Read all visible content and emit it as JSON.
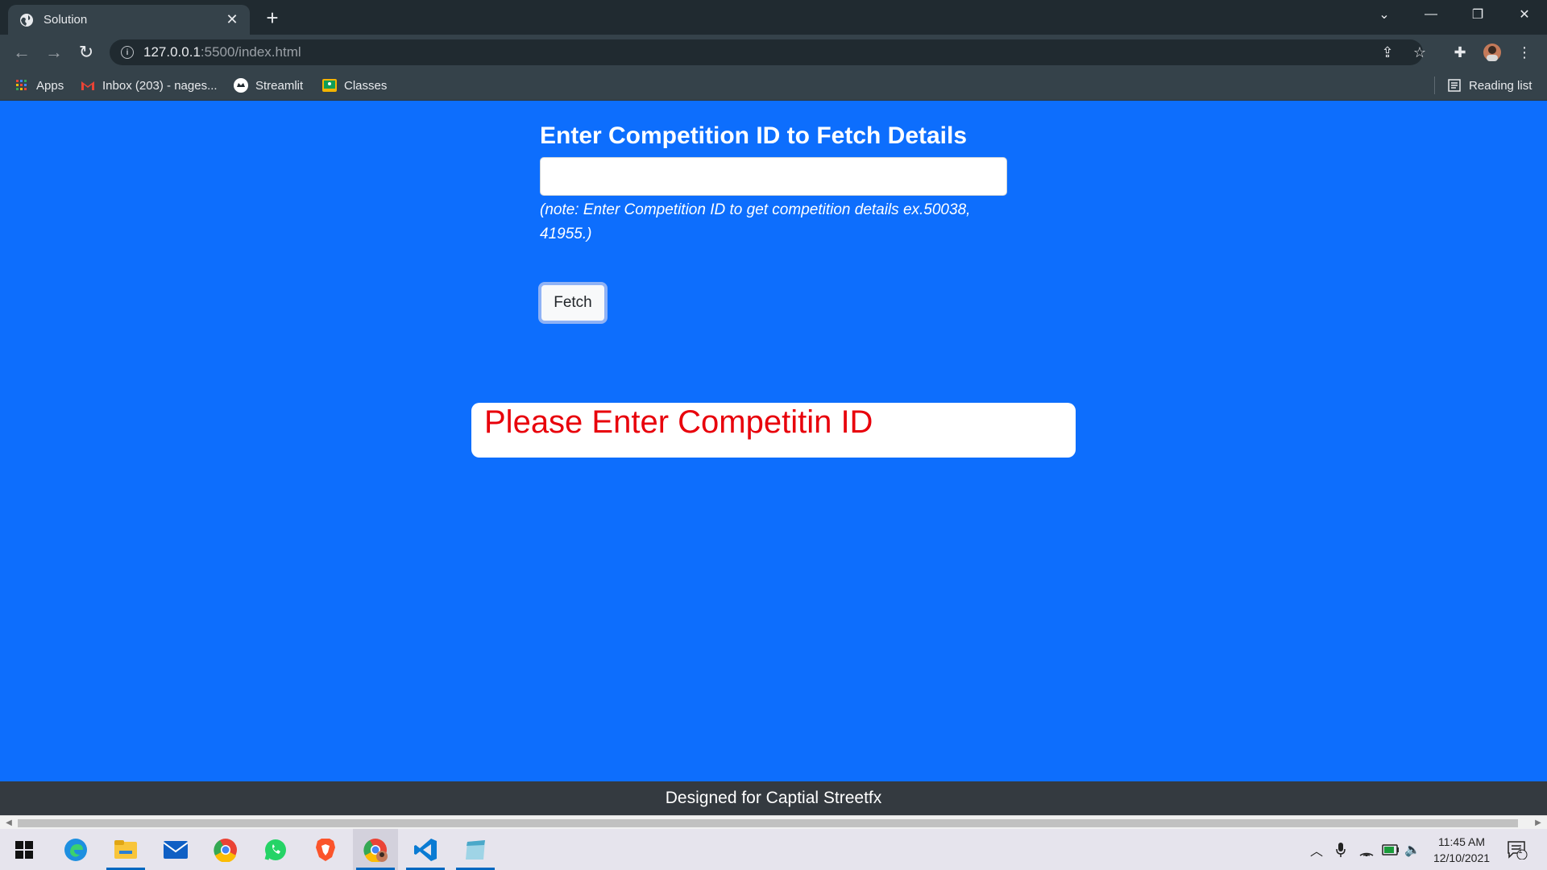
{
  "browser": {
    "tab_title": "Solution",
    "tab_close": "✕",
    "new_tab": "+",
    "url_host": "127.0.0.1",
    "url_path": ":5500/index.html",
    "bookmarks": [
      {
        "label": "Apps",
        "icon": "apps-grid-icon"
      },
      {
        "label": "Inbox (203) - nages...",
        "icon": "gmail-icon"
      },
      {
        "label": "Streamlit",
        "icon": "streamlit-icon"
      },
      {
        "label": "Classes",
        "icon": "classroom-icon"
      }
    ],
    "reading_list": "Reading list"
  },
  "page": {
    "heading": "Enter Competition ID to Fetch Details",
    "input_value": "",
    "note": "(note: Enter Competition ID to get competition details ex.50038, 41955.)",
    "fetch_label": "Fetch",
    "alert_message": "Please Enter Competitin ID",
    "footer": "Designed for Captial Streetfx",
    "colors": {
      "background": "#0d6efd",
      "alert_text": "#e8000b",
      "footer_bg": "#343a40"
    }
  },
  "taskbar": {
    "apps": [
      "windows-start-icon",
      "edge-icon",
      "file-explorer-icon",
      "mail-icon",
      "chrome-icon",
      "whatsapp-icon",
      "brave-icon",
      "chrome-profile-icon",
      "vscode-icon",
      "notepad-icon"
    ],
    "time": "11:45 AM",
    "date": "12/10/2021",
    "notification_count": "1"
  }
}
